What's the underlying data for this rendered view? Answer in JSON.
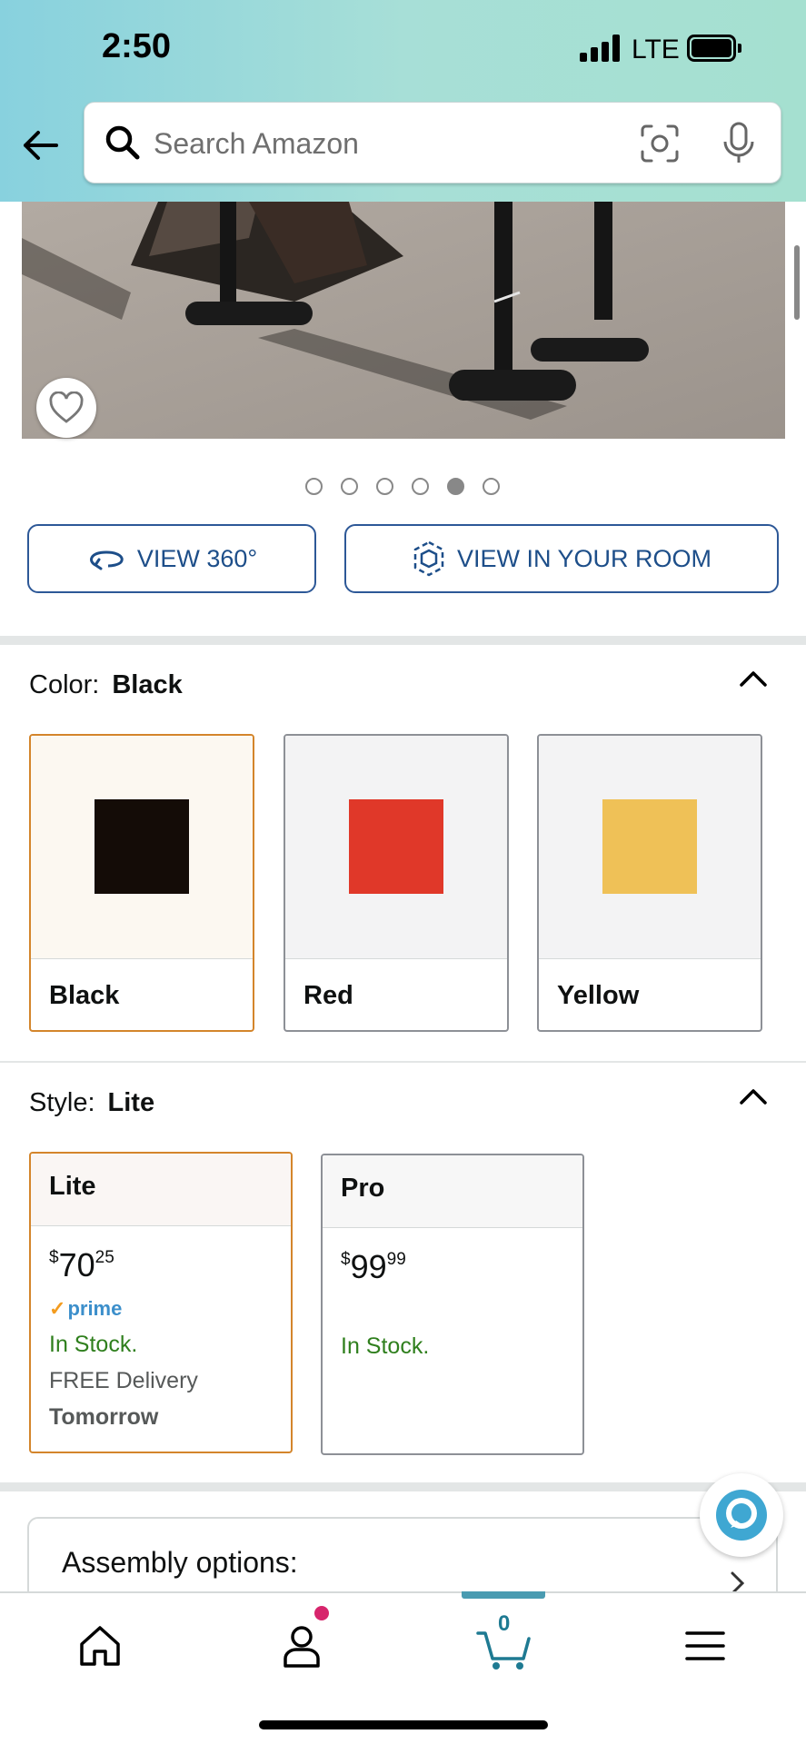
{
  "status_bar": {
    "time": "2:50",
    "network": "LTE"
  },
  "search": {
    "placeholder": "Search Amazon"
  },
  "gallery": {
    "dot_count": 6,
    "active_index": 4
  },
  "view_buttons": {
    "view_360": "VIEW 360°",
    "view_room": "VIEW IN YOUR ROOM"
  },
  "color": {
    "label": "Color:",
    "selected": "Black",
    "options": [
      {
        "name": "Black",
        "hex": "#140c07"
      },
      {
        "name": "Red",
        "hex": "#e03829"
      },
      {
        "name": "Yellow",
        "hex": "#efc157"
      }
    ]
  },
  "style": {
    "label": "Style:",
    "selected": "Lite",
    "options": [
      {
        "name": "Lite",
        "price_symbol": "$",
        "price_whole": "70",
        "price_fraction": "25",
        "prime": "prime",
        "stock": "In Stock.",
        "delivery": "FREE Delivery",
        "delivery_day": "Tomorrow"
      },
      {
        "name": "Pro",
        "price_symbol": "$",
        "price_whole": "99",
        "price_fraction": "99",
        "stock": "In Stock."
      }
    ]
  },
  "assembly": {
    "title": "Assembly options:"
  },
  "cart": {
    "count": "0"
  },
  "colors": {
    "accent_blue": "#1d4e89",
    "selected_border": "#d4852b",
    "stock_green": "#2f7f1d",
    "cart_teal": "#4a9bb1"
  }
}
